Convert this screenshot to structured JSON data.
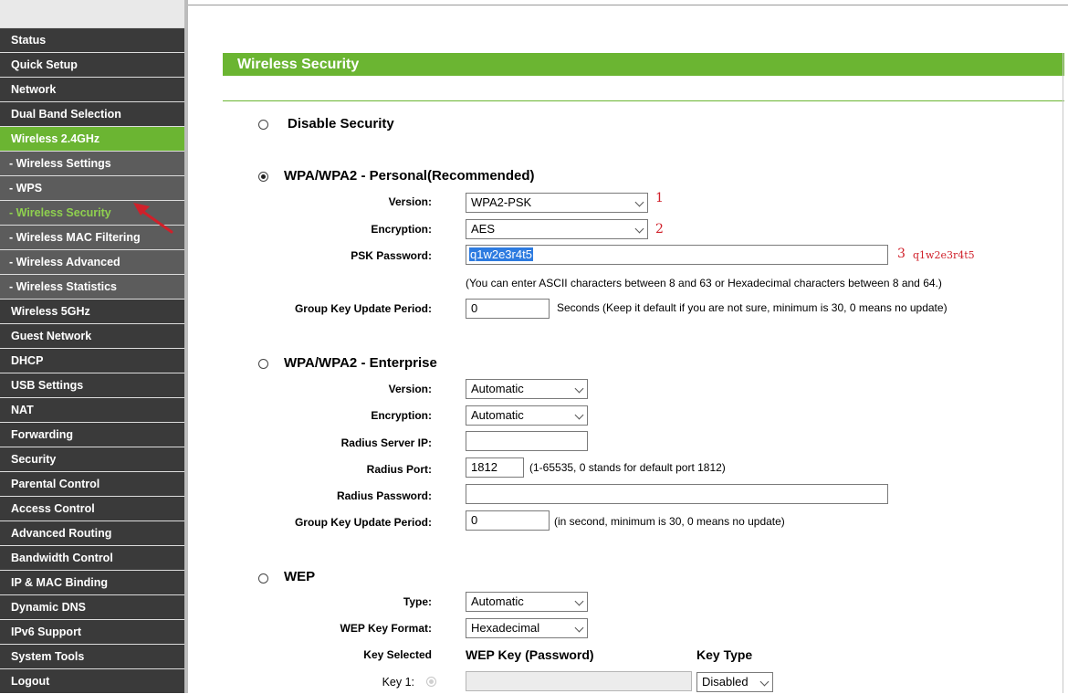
{
  "sidebar": {
    "items": [
      {
        "label": "Status",
        "type": "main"
      },
      {
        "label": "Quick Setup",
        "type": "main"
      },
      {
        "label": "Network",
        "type": "main"
      },
      {
        "label": "Dual Band Selection",
        "type": "main"
      },
      {
        "label": "Wireless 2.4GHz",
        "type": "active"
      },
      {
        "label": "- Wireless Settings",
        "type": "sub"
      },
      {
        "label": "- WPS",
        "type": "sub"
      },
      {
        "label": "- Wireless Security",
        "type": "subactive"
      },
      {
        "label": "- Wireless MAC Filtering",
        "type": "sub"
      },
      {
        "label": "- Wireless Advanced",
        "type": "sub"
      },
      {
        "label": "- Wireless Statistics",
        "type": "sub"
      },
      {
        "label": "Wireless 5GHz",
        "type": "main"
      },
      {
        "label": "Guest Network",
        "type": "main"
      },
      {
        "label": "DHCP",
        "type": "main"
      },
      {
        "label": "USB Settings",
        "type": "main"
      },
      {
        "label": "NAT",
        "type": "main"
      },
      {
        "label": "Forwarding",
        "type": "main"
      },
      {
        "label": "Security",
        "type": "main"
      },
      {
        "label": "Parental Control",
        "type": "main"
      },
      {
        "label": "Access Control",
        "type": "main"
      },
      {
        "label": "Advanced Routing",
        "type": "main"
      },
      {
        "label": "Bandwidth Control",
        "type": "main"
      },
      {
        "label": "IP & MAC Binding",
        "type": "main"
      },
      {
        "label": "Dynamic DNS",
        "type": "main"
      },
      {
        "label": "IPv6 Support",
        "type": "main"
      },
      {
        "label": "System Tools",
        "type": "main"
      },
      {
        "label": "Logout",
        "type": "main"
      }
    ]
  },
  "header": {
    "title": "Wireless Security"
  },
  "disable": {
    "label": "Disable Security"
  },
  "personal": {
    "title": "WPA/WPA2 - Personal(Recommended)",
    "version_label": "Version:",
    "version_value": "WPA2-PSK",
    "encryption_label": "Encryption:",
    "encryption_value": "AES",
    "psk_label": "PSK Password:",
    "psk_value": "q1w2e3r4t5",
    "psk_hint": "(You can enter ASCII characters between 8 and 63 or Hexadecimal characters between 8 and 64.)",
    "gkup_label": "Group Key Update Period:",
    "gkup_value": "0",
    "gkup_hint": "Seconds (Keep it default if you are not sure, minimum is 30, 0 means no update)"
  },
  "annotations": {
    "one": "1",
    "two": "2",
    "three": "3",
    "password_note": "q1w2e3r4t5"
  },
  "enterprise": {
    "title": "WPA/WPA2 - Enterprise",
    "version_label": "Version:",
    "version_value": "Automatic",
    "encryption_label": "Encryption:",
    "encryption_value": "Automatic",
    "radius_ip_label": "Radius Server IP:",
    "radius_ip_value": "",
    "radius_port_label": "Radius Port:",
    "radius_port_value": "1812",
    "radius_port_hint": "(1-65535, 0 stands for default port 1812)",
    "radius_pw_label": "Radius Password:",
    "radius_pw_value": "",
    "gkup_label": "Group Key Update Period:",
    "gkup_value": "0",
    "gkup_hint": "(in second, minimum is 30, 0 means no update)"
  },
  "wep": {
    "title": "WEP",
    "type_label": "Type:",
    "type_value": "Automatic",
    "format_label": "WEP Key Format:",
    "format_value": "Hexadecimal",
    "key_selected_label": "Key Selected",
    "col_key": "WEP Key (Password)",
    "col_type": "Key Type",
    "key1_label": "Key 1:",
    "key1_value": "",
    "key1_type": "Disabled"
  },
  "colors": {
    "accent": "#6bb532",
    "menu_bg": "#3a3a3a",
    "submenu_bg": "#5c5c5c",
    "annotation": "#d0202a"
  },
  "icons": {
    "arrow": "red-pointer-arrow-icon",
    "chevron": "chevron-down-icon"
  }
}
